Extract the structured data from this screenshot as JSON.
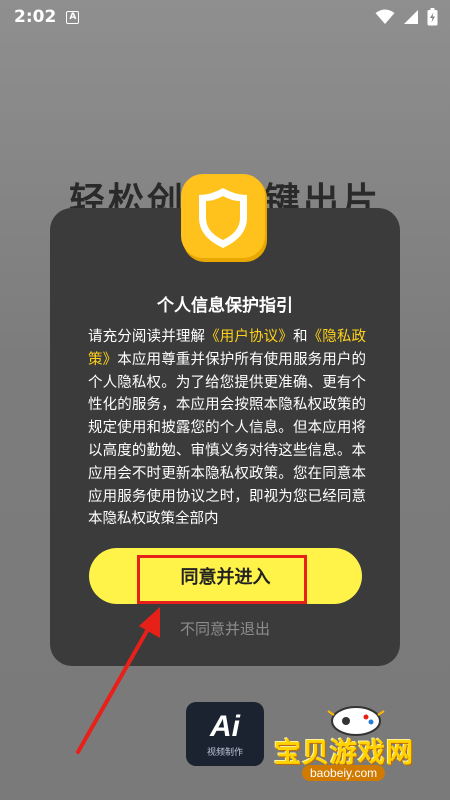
{
  "status_bar": {
    "time": "2:02",
    "left_icon": "A"
  },
  "background": {
    "headline": "轻松创作一键出片",
    "app_logo": {
      "text": "Ai",
      "caption": "视频制作"
    }
  },
  "dialog": {
    "icon": "shield-check-icon",
    "title": "个人信息保护指引",
    "body": {
      "intro": "请充分阅读并理解",
      "link1": "《用户协议》",
      "and": "和",
      "link2": "《隐私政策》",
      "text": "本应用尊重并保护所有使用服务用户的个人隐私权。为了给您提供更准确、更有个性化的服务，本应用会按照本隐私权政策的规定使用和披露您的个人信息。但本应用将以高度的勤勉、审慎义务对待这些信息。本应用会不时更新本隐私权政策。您在同意本应用服务使用协议之时，即视为您已经同意本隐私权政策全部内"
    },
    "agree_label": "同意并进入",
    "decline_label": "不同意并退出"
  },
  "watermark": {
    "title": "宝贝游戏网",
    "url": "baobeiy.com"
  },
  "colors": {
    "accent_yellow": "#fff34a",
    "link_yellow": "#ffd21a",
    "dialog_bg": "#3b3b3b",
    "annotation_red": "#e8201a"
  }
}
